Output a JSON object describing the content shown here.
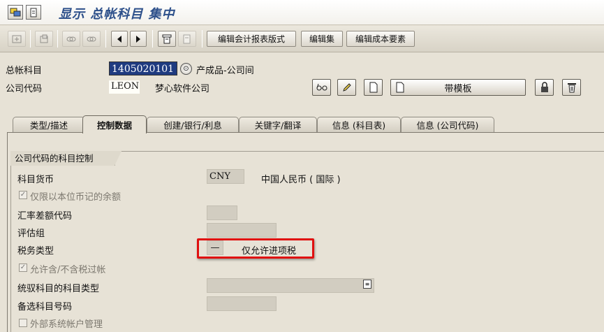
{
  "window": {
    "title": "显示 总帐科目 集中"
  },
  "toolbar": {
    "btn_edit_fs_version": "编辑会计报表版式",
    "btn_edit_set": "编辑集",
    "btn_edit_cost_element": "编辑成本要素"
  },
  "header": {
    "gl_account_label": "总帐科目",
    "gl_account_value": "1405020101",
    "gl_account_desc": "产成品-公司间",
    "company_code_label": "公司代码",
    "company_code_value": "LEON",
    "company_name": "梦心软件公司",
    "btn_with_template": "带模板"
  },
  "tabs": [
    {
      "label": "类型/描述"
    },
    {
      "label": "控制数据"
    },
    {
      "label": "创建/银行/利息"
    },
    {
      "label": "关键字/翻译"
    },
    {
      "label": "信息 (科目表)"
    },
    {
      "label": "信息 (公司代码)"
    }
  ],
  "group": {
    "title": "公司代码的科目控制",
    "account_currency_label": "科目货币",
    "account_currency_value": "CNY",
    "account_currency_desc": "中国人民币 ( 国际 )",
    "local_currency_only_label": "仅限以本位币记的余额",
    "exchange_rate_diff_label": "汇率差额代码",
    "valuation_group_label": "评估组",
    "tax_category_label": "税务类型",
    "tax_category_value": "—",
    "tax_category_desc": "仅允许进项税",
    "posting_without_tax_label": "允许含/不含税过帐",
    "recon_account_label": "统驭科目的科目类型",
    "alt_account_label": "备选科目号码",
    "external_mgmt_label": "外部系统帐户管理"
  }
}
